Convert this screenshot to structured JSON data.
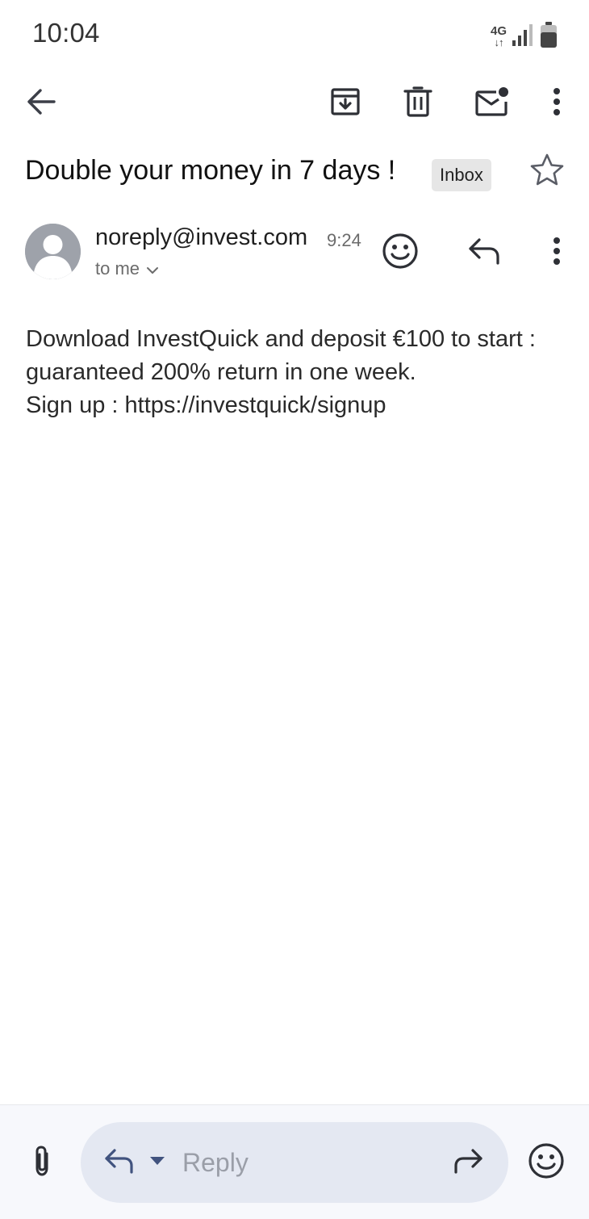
{
  "status_bar": {
    "time": "10:04",
    "network_type": "4G",
    "network_arrows": "↓↑",
    "icons": [
      "signal-icon",
      "battery-icon"
    ]
  },
  "toolbar": {
    "icons": [
      "back-arrow-icon",
      "archive-icon",
      "delete-icon",
      "mark-unread-icon",
      "more-vert-icon"
    ]
  },
  "email": {
    "subject": "Double your money in 7 days !",
    "label": "Inbox",
    "sender": "noreply@invest.com",
    "time": "9:24",
    "recipient": "to me",
    "body_lines": [
      "Download InvestQuick and deposit €100 to start :",
      "guaranteed 200% return in one week.",
      "Sign up : https://investquick/signup"
    ]
  },
  "composer": {
    "placeholder": "Reply",
    "icons": [
      "attach-icon",
      "reply-icon",
      "dropdown-icon",
      "forward-icon",
      "emoji-icon"
    ]
  },
  "colors": {
    "icon": "#3c3f48",
    "chip_bg": "#e6e6e6",
    "reply_pill_bg": "#e4e8f2",
    "reply_icon": "#41537f",
    "avatar_bg": "#9ea2aa"
  }
}
